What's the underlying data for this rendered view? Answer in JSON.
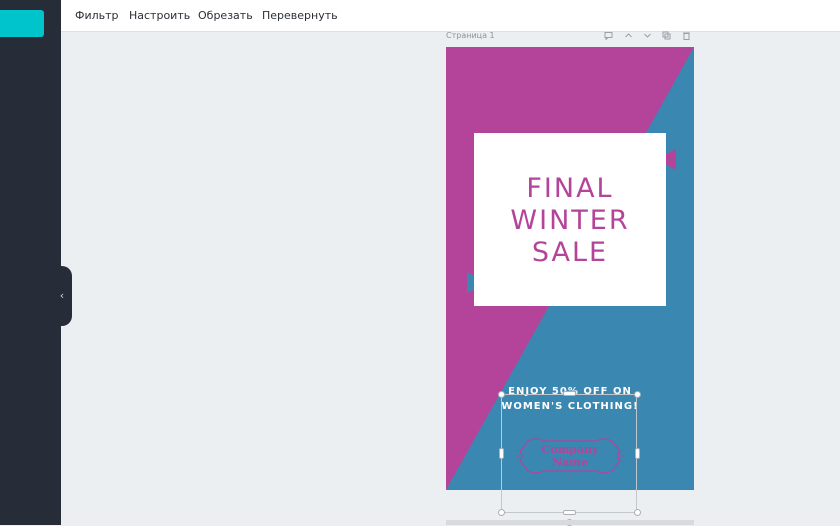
{
  "toolbar": {
    "filter_label": "Фильтр",
    "adjust_label": "Настроить",
    "crop_label": "Обрезать",
    "flip_label": "Перевернуть"
  },
  "sidebar": {
    "collapse_icon": "chevron-left-icon",
    "collapse_glyph": "‹"
  },
  "page": {
    "label": "Страница 1",
    "tools": [
      "notes-icon",
      "chevron-up-icon",
      "chevron-down-icon",
      "copy-icon",
      "trash-icon"
    ]
  },
  "design": {
    "headline": [
      "FINAL",
      "WINTER",
      "SALE"
    ],
    "promo": [
      "ENJOY 50% OFF ON",
      "WOMEN'S CLOTHING!"
    ],
    "company": [
      "Company",
      "Name"
    ]
  },
  "colors": {
    "magenta": "#b3449a",
    "blue": "#3a87b1",
    "sidebar": "#272d38",
    "accent": "#00c4cc"
  }
}
